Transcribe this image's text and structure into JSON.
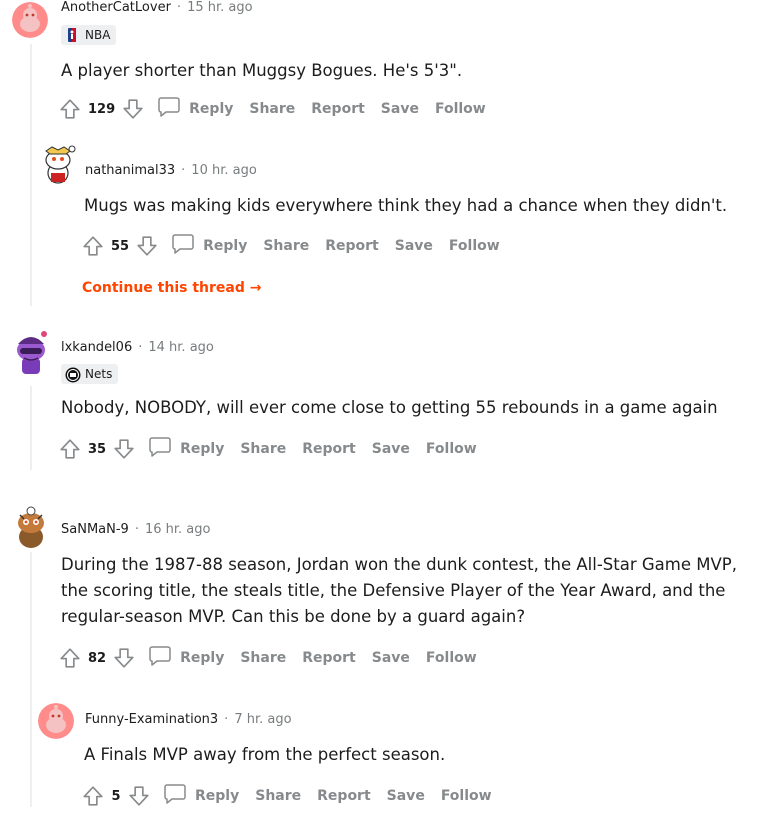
{
  "comments": [
    {
      "user": "AnotherCatLover",
      "time": "15 hr. ago",
      "flair": "NBA",
      "body": "A player shorter than Muggsy Bogues. He's 5'3\".",
      "score": "129"
    },
    {
      "user": "nathanimal33",
      "time": "10 hr. ago",
      "body": "Mugs was making kids everywhere think they had a chance when they didn't.",
      "score": "55",
      "continue": "Continue this thread →"
    },
    {
      "user": "lxkandel06",
      "time": "14 hr. ago",
      "flair": "Nets",
      "body": "Nobody, NOBODY, will ever come close to getting 55 rebounds in a game again",
      "score": "35"
    },
    {
      "user": "SaNMaN-9",
      "time": "16 hr. ago",
      "body_lines": [
        "During the 1987-88 season, Jordan won the dunk contest, the All-Star Game MVP,",
        "the scoring title, the steals title, the Defensive Player of the Year Award, and the",
        "regular-season MVP. Can this be done by a guard again?"
      ],
      "score": "82"
    },
    {
      "user": "Funny-Examination3",
      "time": "7 hr. ago",
      "body": "A Finals MVP away from the perfect season.",
      "score": "5"
    }
  ],
  "actions": {
    "reply": "Reply",
    "share": "Share",
    "report": "Report",
    "save": "Save",
    "follow": "Follow"
  },
  "separator": "·",
  "colors": {
    "accent": "#ff4500",
    "muted": "#878a8c",
    "thread_line": "#edeff1",
    "flair_bg": "#edeff1"
  },
  "icons": [
    "upvote-icon",
    "downvote-icon",
    "comment-bubble-icon",
    "nba-logo-icon",
    "nets-logo-icon"
  ]
}
